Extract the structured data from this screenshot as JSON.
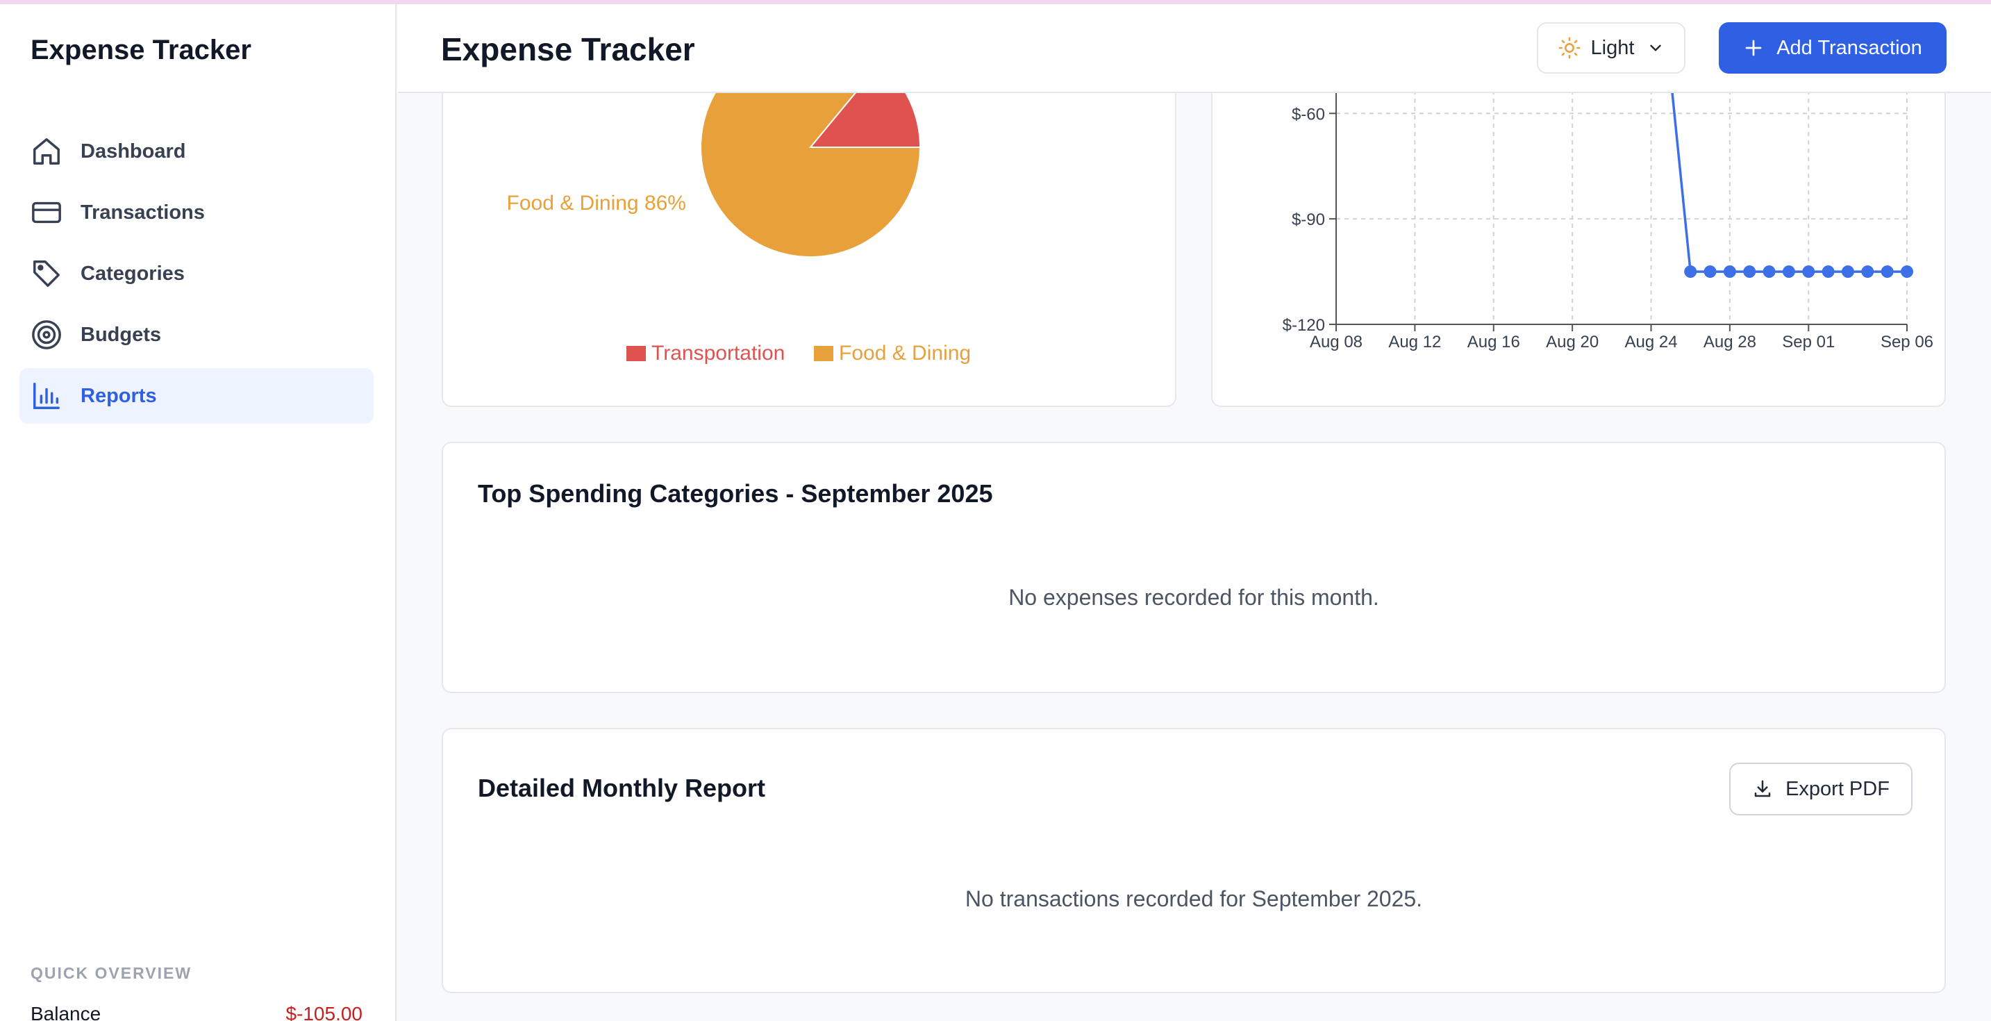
{
  "app": {
    "brand": "Expense Tracker"
  },
  "sidebar": {
    "items": [
      {
        "label": "Dashboard",
        "icon": "home-icon"
      },
      {
        "label": "Transactions",
        "icon": "credit-card-icon"
      },
      {
        "label": "Categories",
        "icon": "tag-icon"
      },
      {
        "label": "Budgets",
        "icon": "target-icon"
      },
      {
        "label": "Reports",
        "icon": "bar-chart-icon",
        "active": true
      }
    ],
    "quick_overview": {
      "title": "QUICK OVERVIEW",
      "balance_label": "Balance",
      "balance_value": "$-105.00"
    }
  },
  "header": {
    "title": "Expense Tracker",
    "theme_label": "Light",
    "add_label": "Add Transaction"
  },
  "pie_card": {
    "chart_data": {
      "type": "pie",
      "slices": [
        {
          "label": "Transportation",
          "percent": 14,
          "color": "#e05250"
        },
        {
          "label": "Food & Dining",
          "percent": 86,
          "color": "#e8a13a"
        }
      ],
      "slice_label": "Food & Dining 86%",
      "legend": [
        "Transportation",
        "Food & Dining"
      ],
      "legend_position": "bottom"
    }
  },
  "line_card": {
    "chart_data": {
      "type": "line",
      "x_ticks": [
        "Aug 08",
        "Aug 12",
        "Aug 16",
        "Aug 20",
        "Aug 24",
        "Aug 28",
        "Sep 01",
        "Sep 06"
      ],
      "y_ticks": [
        "$-60",
        "$-90",
        "$-120"
      ],
      "ylim": [
        -120,
        -40
      ],
      "color": "#3d6fe6",
      "grid": true,
      "series": [
        {
          "x": [
            "Aug 25",
            "Aug 26",
            "Aug 27",
            "Aug 28",
            "Aug 29",
            "Aug 30",
            "Aug 31",
            "Sep 01",
            "Sep 02",
            "Sep 03",
            "Sep 04",
            "Sep 05",
            "Sep 06"
          ],
          "y": [
            -50,
            -105,
            -105,
            -105,
            -105,
            -105,
            -105,
            -105,
            -105,
            -105,
            -105,
            -105,
            -105
          ]
        }
      ]
    }
  },
  "top_spending": {
    "title": "Top Spending Categories - September 2025",
    "empty": "No expenses recorded for this month."
  },
  "monthly_report": {
    "title": "Detailed Monthly Report",
    "export_label": "Export PDF",
    "empty": "No transactions recorded for September 2025."
  }
}
